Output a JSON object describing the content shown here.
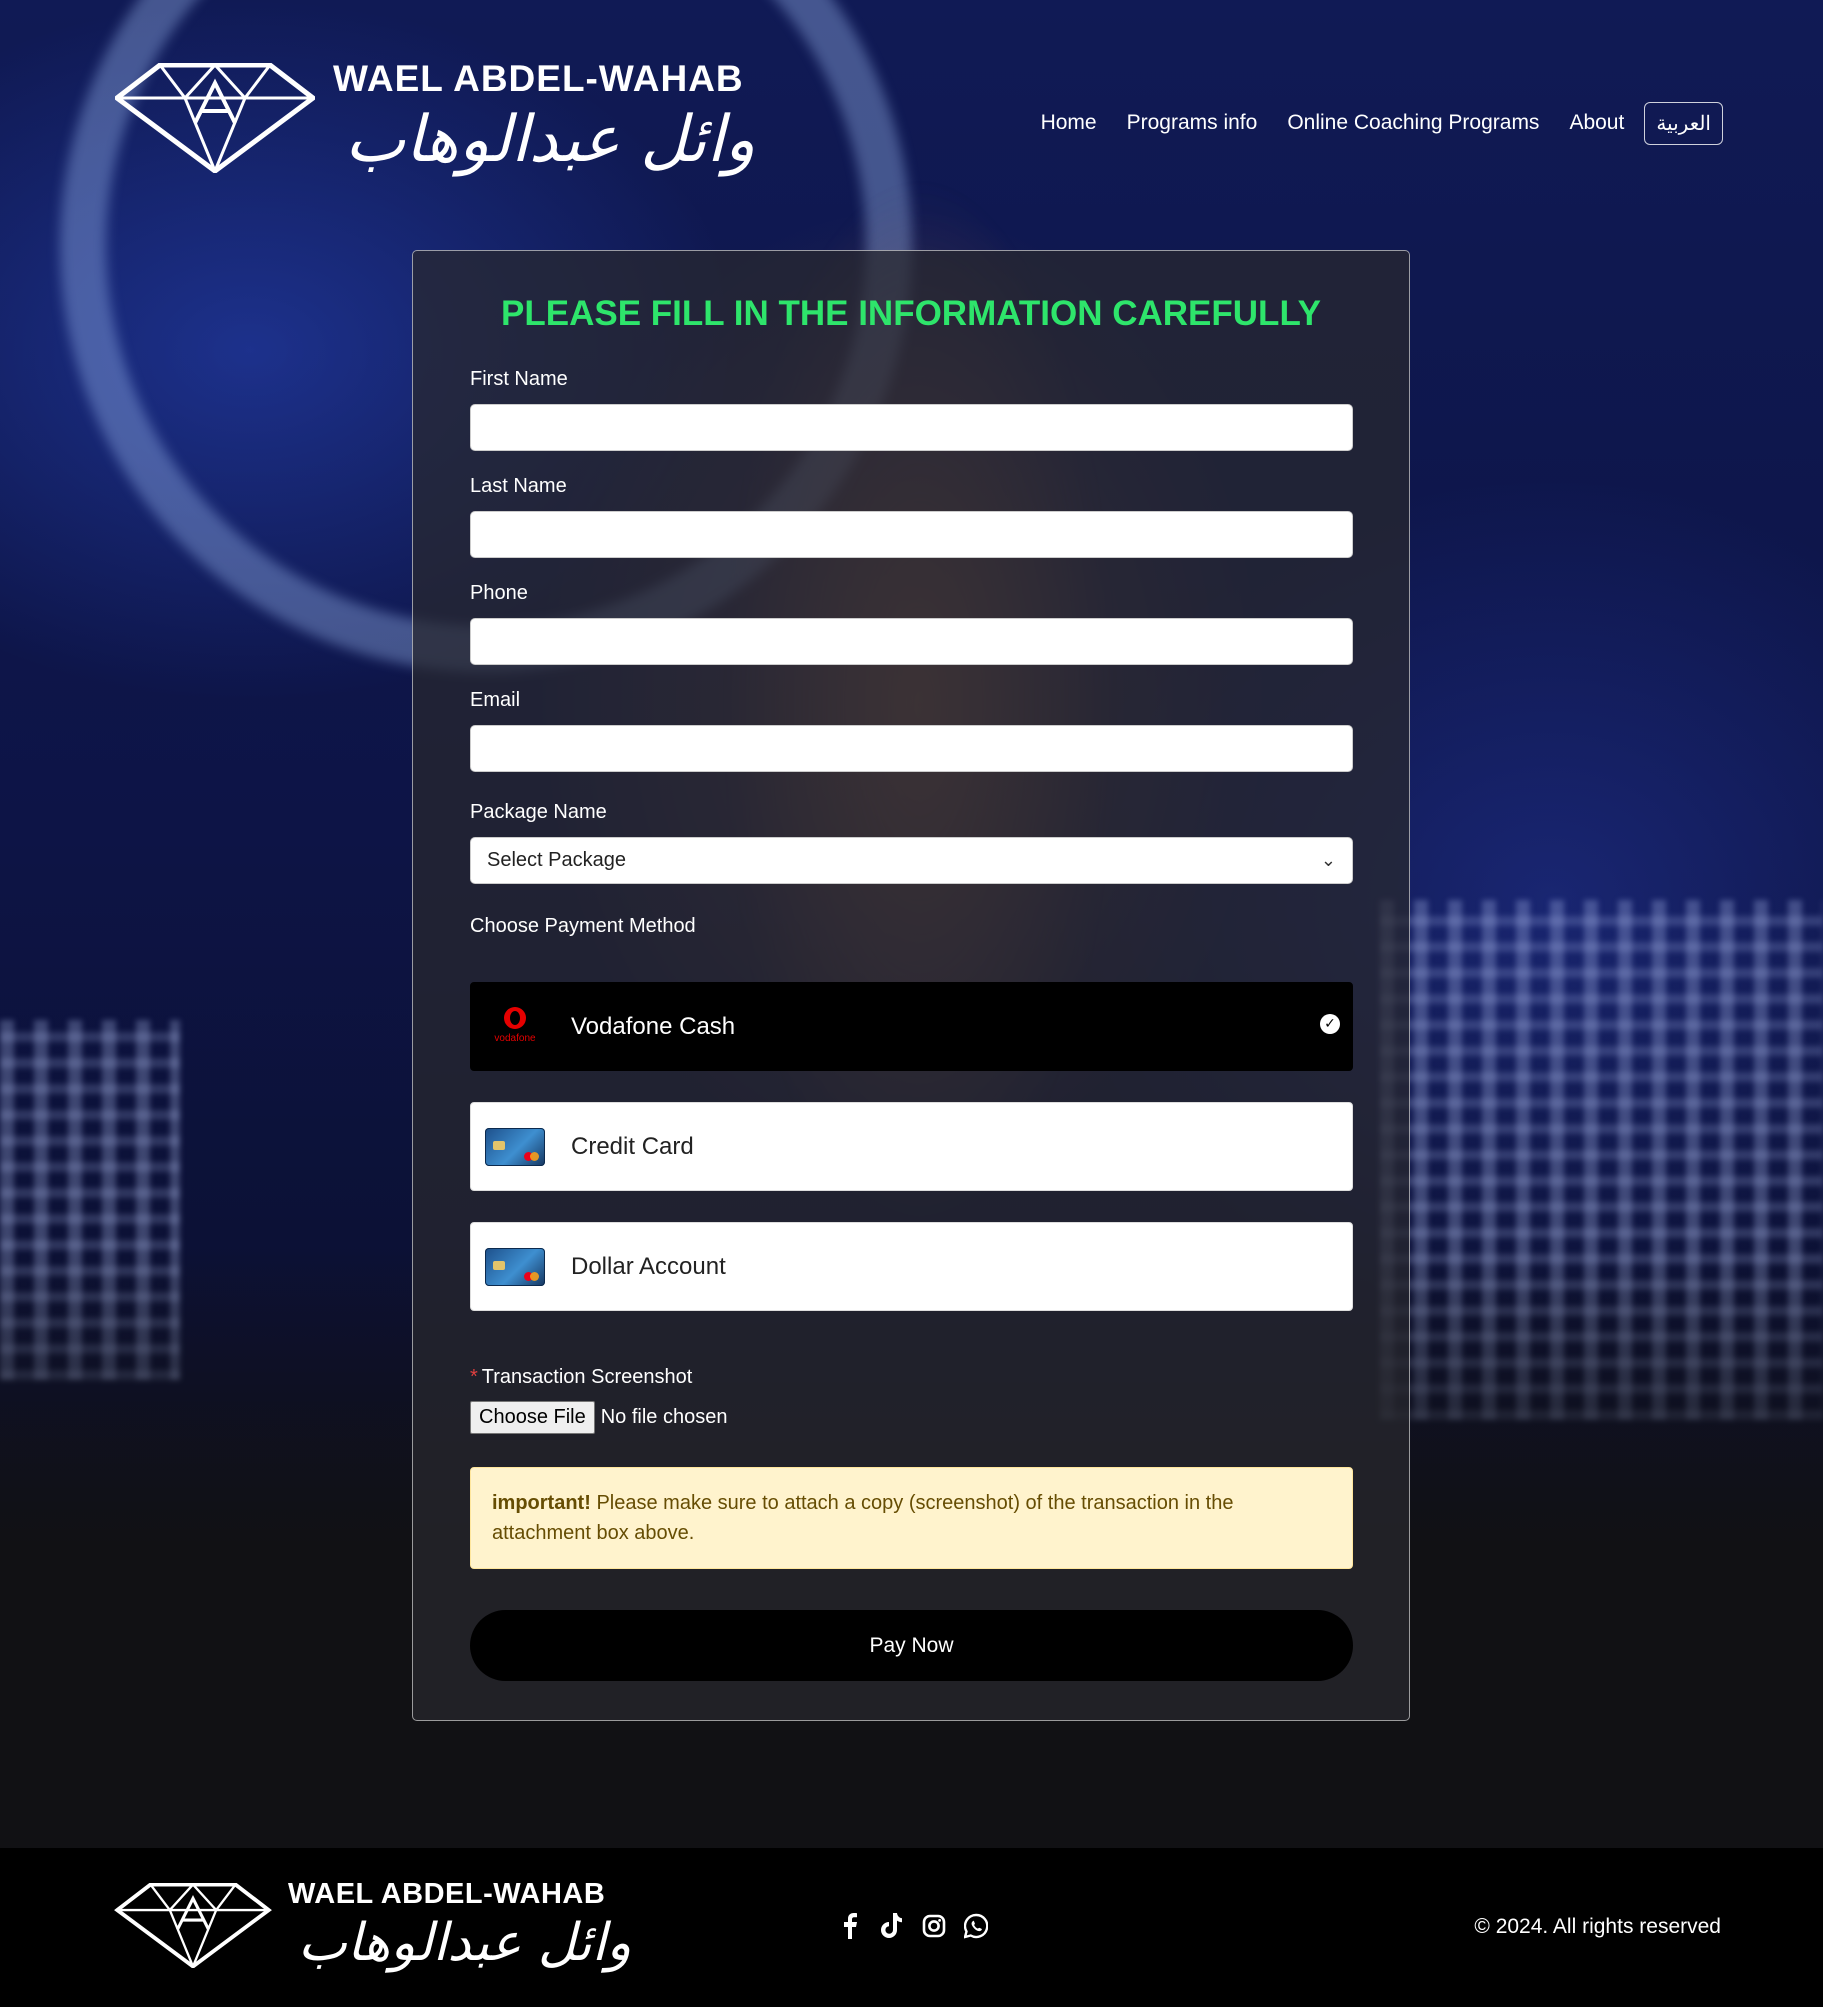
{
  "header": {
    "brand_en": "WAEL ABDEL-WAHAB",
    "brand_ar": "وائل عبدالوهاب",
    "nav": {
      "home": "Home",
      "programs_info": "Programs info",
      "online_coaching": "Online Coaching Programs",
      "about": "About",
      "language": "العربية"
    }
  },
  "form": {
    "title": "PLEASE FILL IN THE INFORMATION CAREFULLY",
    "first_name_label": "First Name",
    "first_name_value": "",
    "last_name_label": "Last Name",
    "last_name_value": "",
    "phone_label": "Phone",
    "phone_value": "",
    "email_label": "Email",
    "email_value": "",
    "package_label": "Package Name",
    "package_selected": "Select Package",
    "payment_label": "Choose Payment Method",
    "payment_methods": [
      {
        "name": "Vodafone Cash",
        "icon": "vodafone-logo",
        "selected": true
      },
      {
        "name": "Credit Card",
        "icon": "credit-card-icon",
        "selected": false
      },
      {
        "name": "Dollar Account",
        "icon": "credit-card-icon",
        "selected": false
      }
    ],
    "vodafone_logo_text": "vodafone",
    "upload_label": "Transaction Screenshot",
    "upload_required_mark": "*",
    "upload_button": "Choose File",
    "upload_status": "No file chosen",
    "alert_strong": "important!",
    "alert_text": "Please make sure to attach a copy (screenshot) of the transaction in the attachment box above.",
    "submit": "Pay Now"
  },
  "footer": {
    "brand_en": "WAEL ABDEL-WAHAB",
    "brand_ar": "وائل عبدالوهاب",
    "social": [
      "facebook-icon",
      "tiktok-icon",
      "instagram-icon",
      "whatsapp-icon"
    ],
    "copyright": "© 2024. All rights reserved"
  },
  "colors": {
    "title_green": "#2ee56b",
    "vodafone_red": "#e60000",
    "alert_bg": "#fff3cd"
  }
}
